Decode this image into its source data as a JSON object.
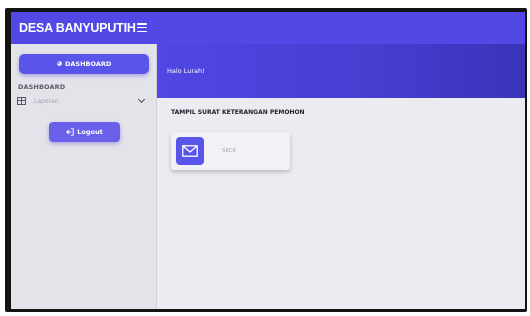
{
  "sidebar": {
    "brand": "DESA BANYUPUTIH",
    "dashboard_button": "DASHBOARD",
    "section_label": "DASHBOARD",
    "menu": [
      {
        "label": "Laporan",
        "icon": "table-icon"
      }
    ],
    "logout_button": "Logout"
  },
  "main": {
    "greeting": "Halo Lurah!",
    "content_title": "TAMPIL SURAT KETERANGAN PEMOHON",
    "cards": [
      {
        "label": "SKCK",
        "icon": "envelope-icon"
      }
    ]
  },
  "colors": {
    "primary": "#5148e6",
    "hero_end": "#3a33b8",
    "sidebar_bg": "#e3e3ea",
    "content_bg": "#ebebf1"
  }
}
